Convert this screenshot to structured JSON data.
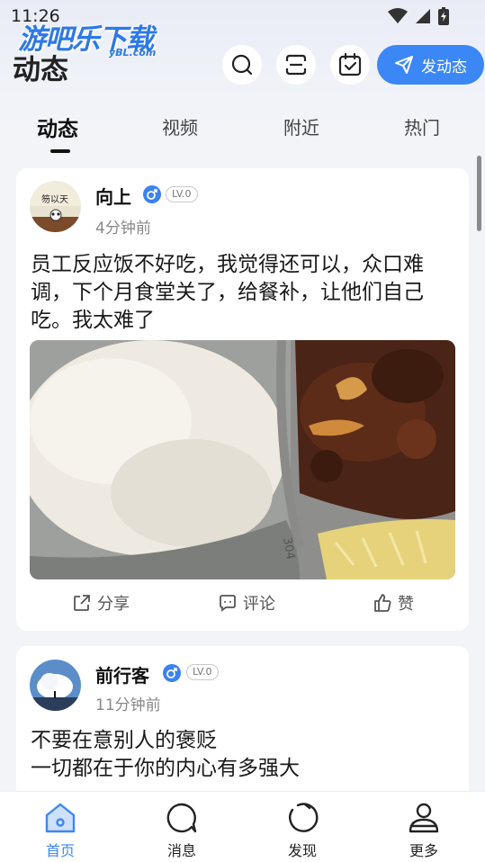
{
  "status_bar": {
    "time": "11:26"
  },
  "watermark": {
    "text": "游吧乐下载",
    "sub": "yBL.com"
  },
  "header": {
    "title": "动态",
    "post_button_label": "发动态"
  },
  "tabs": [
    {
      "label": "动态",
      "active": true
    },
    {
      "label": "视频",
      "active": false
    },
    {
      "label": "附近",
      "active": false
    },
    {
      "label": "热门",
      "active": false
    }
  ],
  "posts": [
    {
      "username": "向上",
      "gender": "male",
      "level": "LV.0",
      "time": "4分钟前",
      "text": "员工反应饭不好吃，我觉得还可以，众口难调，下个月食堂关了，给餐补，让他们自己吃。我太难了",
      "photo_stamp": "304",
      "actions": {
        "share": "分享",
        "comment": "评论",
        "like": "赞"
      }
    },
    {
      "username": "前行客",
      "gender": "male",
      "level": "LV.0",
      "time": "11分钟前",
      "text_lines": [
        "不要在意别人的褒贬",
        "一切都在于你的内心有多强大"
      ]
    }
  ],
  "bottom_nav": [
    {
      "label": "首页",
      "icon": "home-icon",
      "active": true
    },
    {
      "label": "消息",
      "icon": "message-icon",
      "active": false
    },
    {
      "label": "发现",
      "icon": "discover-icon",
      "active": false
    },
    {
      "label": "更多",
      "icon": "profile-icon",
      "active": false
    }
  ],
  "colors": {
    "accent": "#3b87f6",
    "background": "#f3f4f7",
    "gender": "#3a82f1"
  }
}
